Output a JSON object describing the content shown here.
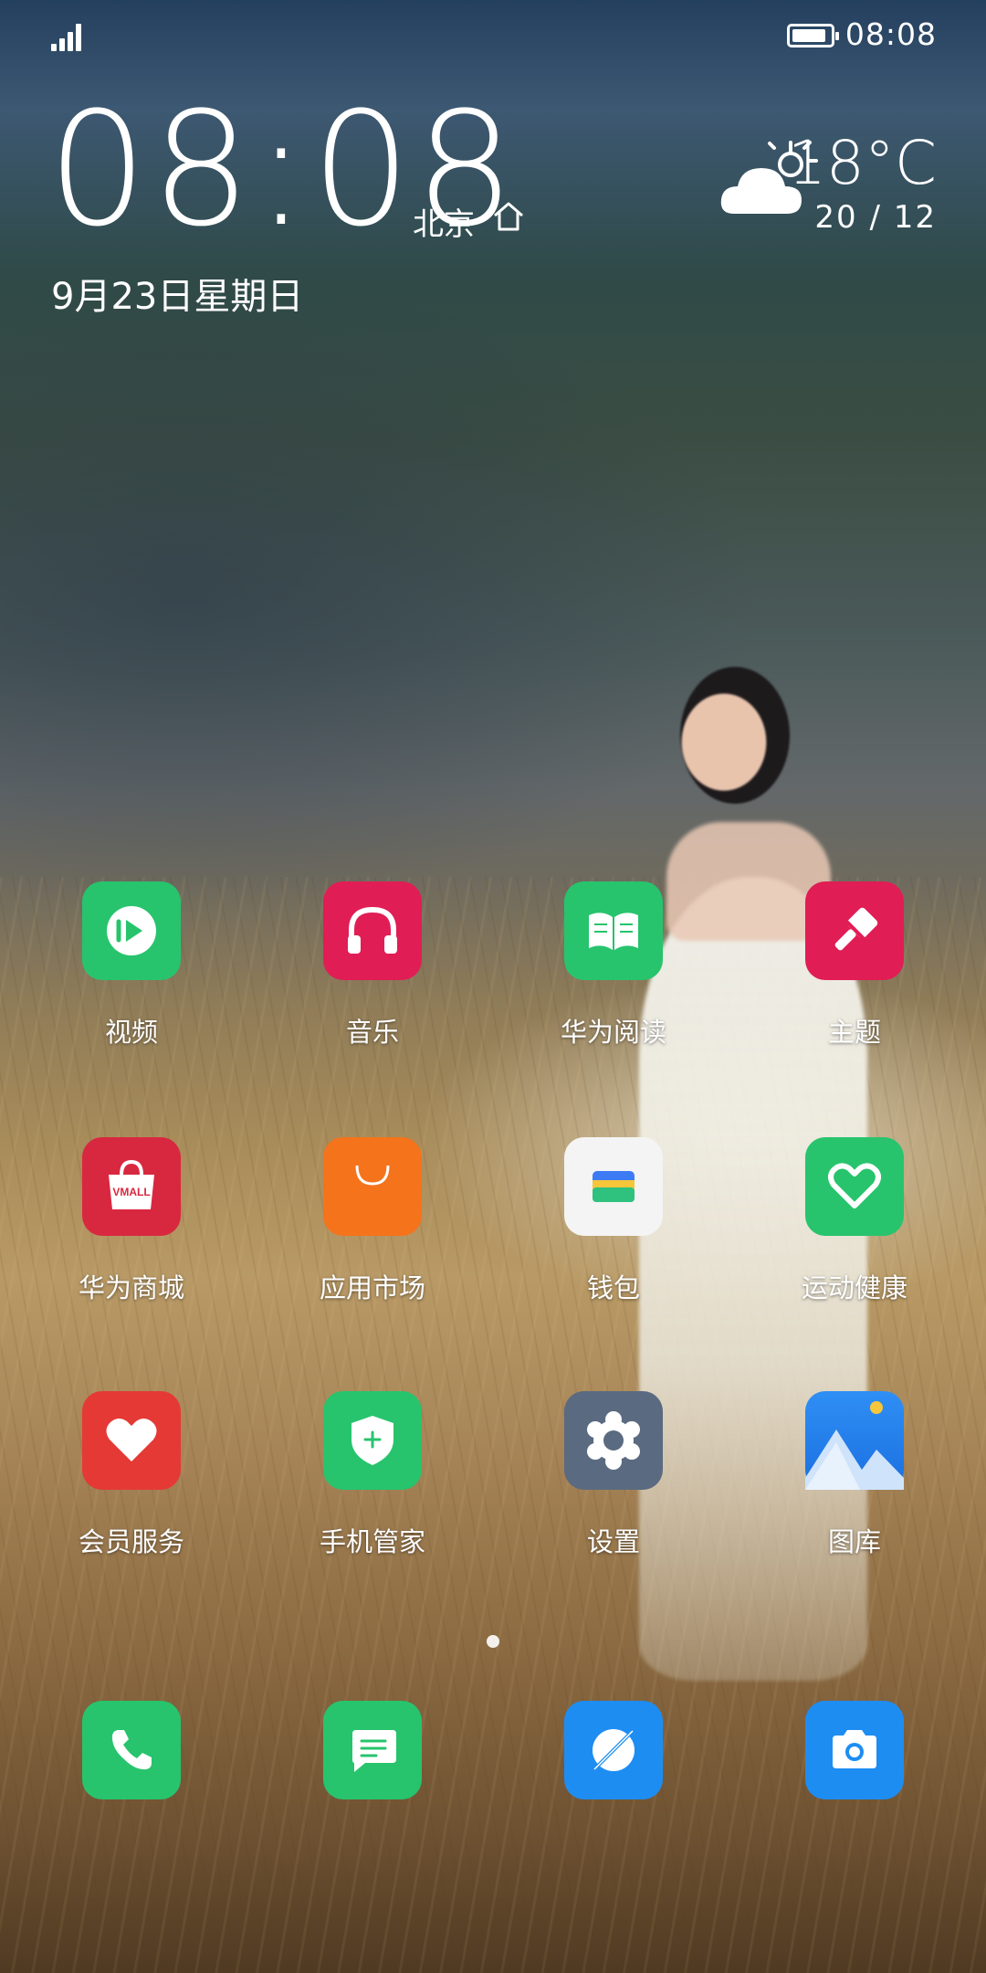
{
  "status_bar": {
    "time": "08:08",
    "battery_level": 0.9
  },
  "clock": {
    "time": "08:08",
    "city": "北京",
    "date": "9月23日星期日"
  },
  "weather": {
    "temperature": "18°C",
    "range": "20 / 12",
    "icon": "partly-cloudy-icon"
  },
  "apps": [
    {
      "label": "视频",
      "icon": "video-play-icon",
      "color": "#27c46d"
    },
    {
      "label": "音乐",
      "icon": "headphones-icon",
      "color": "#e11d55"
    },
    {
      "label": "华为阅读",
      "icon": "open-book-icon",
      "color": "#27c46d"
    },
    {
      "label": "主题",
      "icon": "paint-brush-icon",
      "color": "#e11d55"
    },
    {
      "label": "华为商城",
      "icon": "vmall-bag-icon",
      "color": "#d8283f",
      "badge_text": "VMALL"
    },
    {
      "label": "应用市场",
      "icon": "app-market-bag-icon",
      "color": "#f5731b"
    },
    {
      "label": "钱包",
      "icon": "wallet-icon",
      "color": "#f4f4f4"
    },
    {
      "label": "运动健康",
      "icon": "heart-outline-icon",
      "color": "#27c46d"
    },
    {
      "label": "会员服务",
      "icon": "heart-icon",
      "color": "#e53935"
    },
    {
      "label": "手机管家",
      "icon": "shield-plus-icon",
      "color": "#27c46d"
    },
    {
      "label": "设置",
      "icon": "gear-icon",
      "color": "#5a6a80"
    },
    {
      "label": "图库",
      "icon": "gallery-mountain-icon",
      "color": "#1e8df2"
    }
  ],
  "dock": [
    {
      "icon": "phone-icon",
      "color": "#27c46d"
    },
    {
      "icon": "message-icon",
      "color": "#27c46d"
    },
    {
      "icon": "browser-compass-icon",
      "color": "#1e8df2"
    },
    {
      "icon": "camera-icon",
      "color": "#1e8df2"
    }
  ]
}
